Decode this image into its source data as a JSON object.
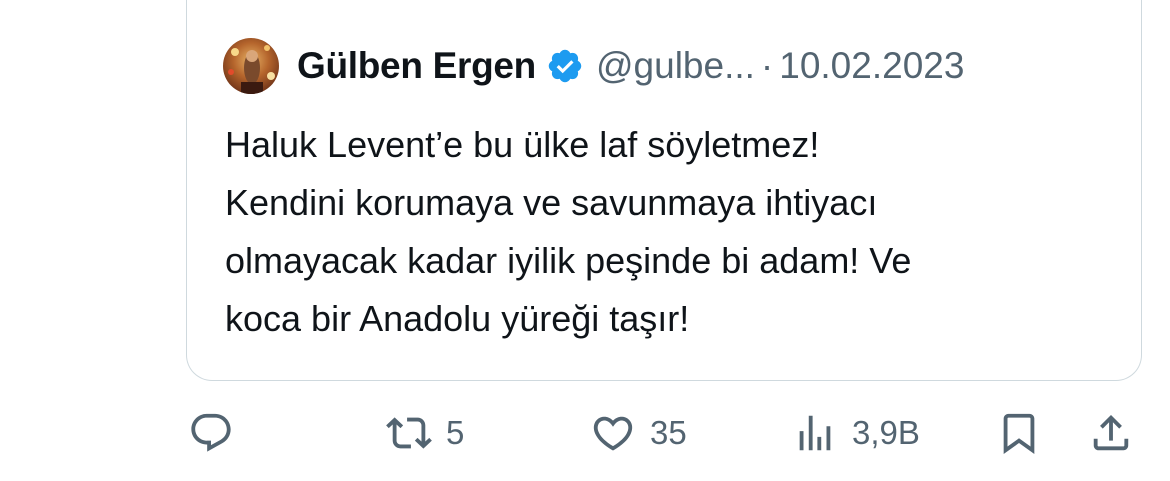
{
  "quote": {
    "display_name": "Gülben Ergen",
    "handle": "@gulbe...",
    "separator": "·",
    "date": "10.02.2023",
    "text_lines": [
      "Haluk Levent’e bu ülke laf söyletmez!",
      "Kendini korumaya ve savunmaya ihtiyacı",
      "olmayacak kadar iyilik peşinde bi adam! Ve",
      "koca bir Anadolu yüreği taşır!"
    ]
  },
  "actions": {
    "reply": {
      "icon": "reply-icon",
      "count": ""
    },
    "retweet": {
      "icon": "retweet-icon",
      "count": "5"
    },
    "like": {
      "icon": "heart-icon",
      "count": "35"
    },
    "views": {
      "icon": "views-icon",
      "count": "3,9B"
    },
    "bookmark": {
      "icon": "bookmark-icon"
    },
    "share": {
      "icon": "share-icon"
    }
  },
  "colors": {
    "text": "#0f1419",
    "secondary": "#536471",
    "border": "#cfd9de",
    "verified": "#1d9bf0"
  }
}
